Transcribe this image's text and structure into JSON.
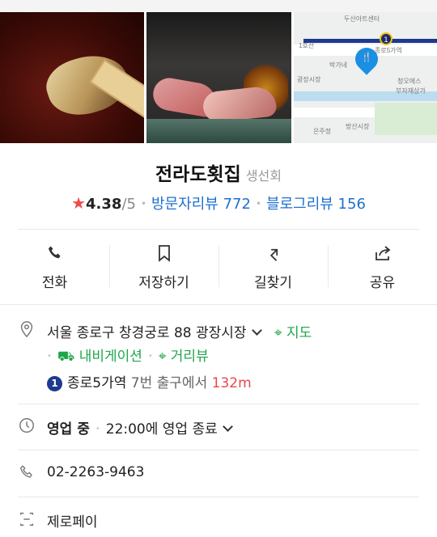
{
  "photos": {
    "map": {
      "labels": [
        "두산아트센터",
        "1호선",
        "종로5가역",
        "박가네",
        "청오에스",
        "부자재상가",
        "은주정",
        "방산시장",
        "광장시장"
      ],
      "station_number": "1"
    }
  },
  "place": {
    "name": "전라도횟집",
    "category": "생선회",
    "rating": "4.38",
    "rating_max": "/5",
    "visitor_reviews": "방문자리뷰 772",
    "blog_reviews": "블로그리뷰 156"
  },
  "actions": [
    {
      "label": "전화",
      "icon": "phone-icon"
    },
    {
      "label": "저장하기",
      "icon": "bookmark-icon"
    },
    {
      "label": "길찾기",
      "icon": "directions-icon"
    },
    {
      "label": "공유",
      "icon": "share-icon"
    }
  ],
  "address": {
    "text": "서울 종로구 창경궁로 88 광장시장",
    "map_link": "지도",
    "navigation_link": "내비게이션",
    "street_view_link": "거리뷰"
  },
  "transit": {
    "line": "1",
    "station": "종로5가역",
    "exit": "7번 출구에서",
    "distance": "132m"
  },
  "hours": {
    "status": "영업 중",
    "detail": "22:00에 영업 종료"
  },
  "phone": "02-2263-9463",
  "payment": "제로페이",
  "colors": {
    "accent_blue": "#1e6fd0",
    "accent_green": "#1fa64a",
    "star_red": "#f14a4a",
    "distance_red": "#e8484a",
    "subway_line1": "#1d3a8f"
  }
}
